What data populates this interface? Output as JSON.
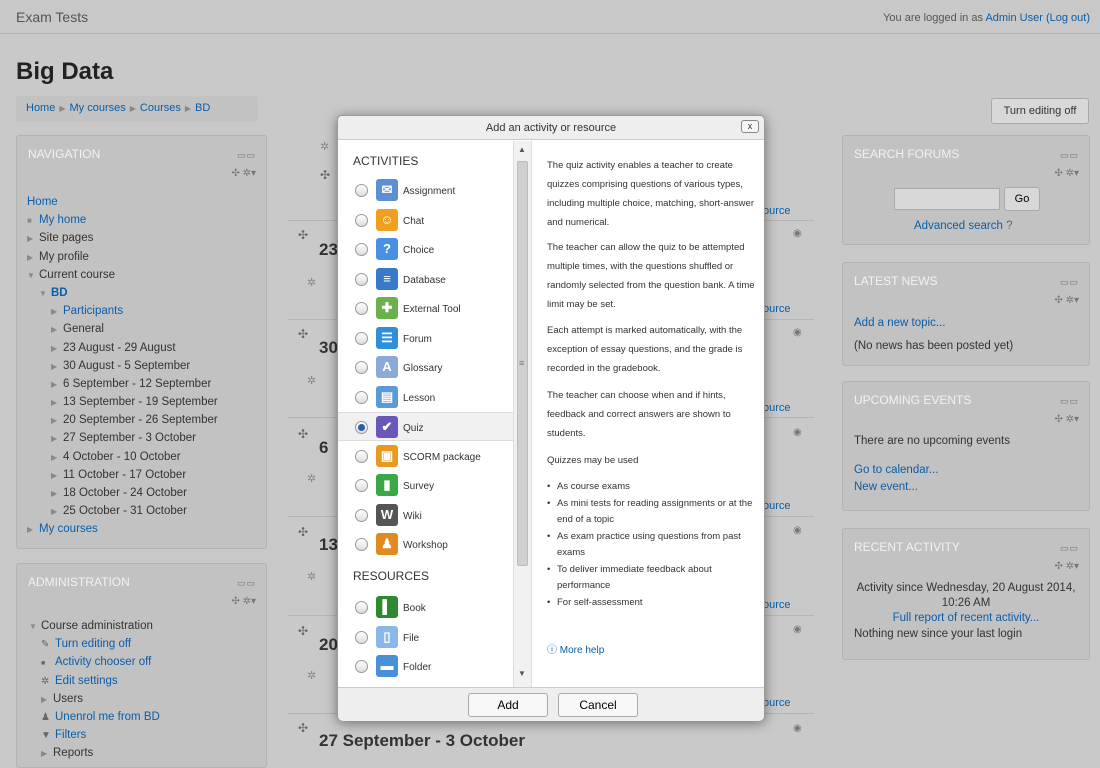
{
  "header": {
    "site_name": "Exam Tests",
    "login_prefix": "You are logged in as ",
    "user": "Admin User",
    "logout": "(Log out)"
  },
  "page_title": "Big Data",
  "breadcrumb": [
    "Home",
    "My courses",
    "Courses",
    "BD"
  ],
  "turn_editing_off": "Turn editing off",
  "navigation": {
    "title": "NAVIGATION",
    "items": [
      "Home",
      "My home",
      "Site pages",
      "My profile",
      "Current course",
      "BD",
      "Participants",
      "General",
      "23 August - 29 August",
      "30 August - 5 September",
      "6 September - 12 September",
      "13 September - 19 September",
      "20 September - 26 September",
      "27 September - 3 October",
      "4 October - 10 October",
      "11 October - 17 October",
      "18 October - 24 October",
      "25 October - 31 October",
      "My courses"
    ]
  },
  "administration": {
    "title": "ADMINISTRATION",
    "items": [
      "Course administration",
      "Turn editing off",
      "Activity chooser off",
      "Edit settings",
      "Users",
      "Unenrol me from BD",
      "Filters",
      "Reports"
    ]
  },
  "sections": {
    "titles": [
      "23",
      "30",
      "6",
      "13",
      "20",
      "27 September - 3 October"
    ],
    "resource_text": "ource"
  },
  "search_forums": {
    "title": "SEARCH FORUMS",
    "go": "Go",
    "advanced": "Advanced search"
  },
  "latest_news": {
    "title": "LATEST NEWS",
    "add_topic": "Add a new topic...",
    "none": "(No news has been posted yet)"
  },
  "upcoming_events": {
    "title": "UPCOMING EVENTS",
    "none": "There are no upcoming events",
    "calendar": "Go to calendar...",
    "new_event": "New event..."
  },
  "recent_activity": {
    "title": "RECENT ACTIVITY",
    "since": "Activity since Wednesday, 20 August 2014,",
    "time": "10:26 AM",
    "full_report": "Full report of recent activity...",
    "nothing": "Nothing new since your last login"
  },
  "dialog": {
    "title": "Add an activity or resource",
    "close": "x",
    "activities_heading": "ACTIVITIES",
    "resources_heading": "RESOURCES",
    "activities": [
      {
        "label": "Assignment",
        "icon": "assignment-icon",
        "color": "#5b8fd6"
      },
      {
        "label": "Chat",
        "icon": "chat-icon",
        "color": "#f0a020"
      },
      {
        "label": "Choice",
        "icon": "choice-icon",
        "color": "#4a90e2"
      },
      {
        "label": "Database",
        "icon": "database-icon",
        "color": "#3a78c8"
      },
      {
        "label": "External Tool",
        "icon": "puzzle-icon",
        "color": "#6ab04c"
      },
      {
        "label": "Forum",
        "icon": "forum-icon",
        "color": "#2f8fd8"
      },
      {
        "label": "Glossary",
        "icon": "glossary-icon",
        "color": "#8aa8d8"
      },
      {
        "label": "Lesson",
        "icon": "lesson-icon",
        "color": "#5a9ad8"
      },
      {
        "label": "Quiz",
        "icon": "quiz-icon",
        "color": "#6a58b8"
      },
      {
        "label": "SCORM package",
        "icon": "scorm-icon",
        "color": "#e89a20"
      },
      {
        "label": "Survey",
        "icon": "survey-icon",
        "color": "#3aa848"
      },
      {
        "label": "Wiki",
        "icon": "wiki-icon",
        "color": "#555555"
      },
      {
        "label": "Workshop",
        "icon": "workshop-icon",
        "color": "#e08a20"
      }
    ],
    "resources": [
      {
        "label": "Book",
        "icon": "book-icon",
        "color": "#2f8a2f"
      },
      {
        "label": "File",
        "icon": "file-icon",
        "color": "#8ab8e8"
      },
      {
        "label": "Folder",
        "icon": "folder-icon",
        "color": "#4a90d8"
      }
    ],
    "selected": "Quiz",
    "help": {
      "p1": "The quiz activity enables a teacher to create quizzes comprising questions of various types, including multiple choice, matching, short-answer and numerical.",
      "p2": "The teacher can allow the quiz to be attempted multiple times, with the questions shuffled or randomly selected from the question bank. A time limit may be set.",
      "p3": "Each attempt is marked automatically, with the exception of essay questions, and the grade is recorded in the gradebook.",
      "p4": "The teacher can choose when and if hints, feedback and correct answers are shown to students.",
      "p5": "Quizzes may be used",
      "bullets": [
        "As course exams",
        "As mini tests for reading assignments or at the end of a topic",
        "As exam practice using questions from past exams",
        "To deliver immediate feedback about performance",
        "For self-assessment"
      ],
      "more": "More help"
    },
    "add": "Add",
    "cancel": "Cancel"
  }
}
